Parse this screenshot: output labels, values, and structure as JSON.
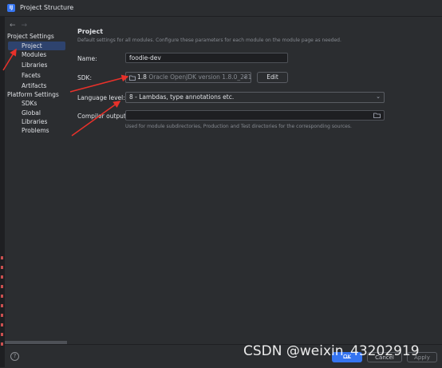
{
  "window": {
    "title": "Project Structure",
    "app_icon": "IJ"
  },
  "nav": {
    "back": "←",
    "forward": "→"
  },
  "sidebar": {
    "project_settings_title": "Project Settings",
    "project_settings_items": [
      "Project",
      "Modules",
      "Libraries",
      "Facets",
      "Artifacts"
    ],
    "platform_settings_title": "Platform Settings",
    "platform_settings_items": [
      "SDKs",
      "Global Libraries"
    ],
    "problems": "Problems",
    "selected": "Project"
  },
  "main": {
    "title": "Project",
    "description": "Default settings for all modules. Configure these parameters for each module on the module page as needed.",
    "name_label": "Name:",
    "name_value": "foodie-dev",
    "sdk_label": "SDK:",
    "sdk_version": "1.8",
    "sdk_detail": "Oracle OpenJDK version 1.8.0_281",
    "edit_label": "Edit",
    "language_level_label": "Language level:",
    "language_level_value": "8 - Lambdas, type annotations etc.",
    "compiler_output_label": "Compiler output:",
    "compiler_output_value": "",
    "compiler_output_hint": "Used for module subdirectories, Production and Test directories for the corresponding sources."
  },
  "footer": {
    "help": "?",
    "ok": "OK",
    "cancel": "Cancel",
    "apply": "Apply"
  },
  "watermark": "CSDN @weixin_43202919",
  "colors": {
    "accent": "#3574f0",
    "selection": "#2e436e",
    "annotation_arrow": "#e8312a"
  }
}
